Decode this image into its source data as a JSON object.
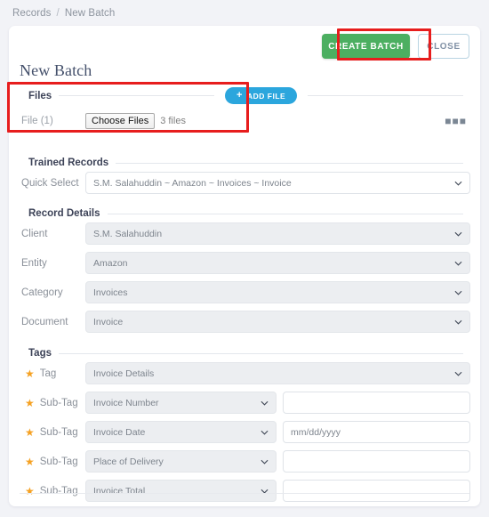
{
  "breadcrumb": {
    "parent": "Records",
    "separator": "/",
    "current": "New Batch"
  },
  "header": {
    "create_batch_label": "CREATE BATCH",
    "close_label": "CLOSE",
    "page_title": "New Batch"
  },
  "colors": {
    "create_button": "#4caf61",
    "add_file_button": "#2ba6dd",
    "highlight_box": "#e71d1d",
    "star": "#f5a122",
    "page_background": "#f2f3f7",
    "disabled_field": "#eceef1"
  },
  "files": {
    "section_label": "Files",
    "add_file_label": "ADD FILE",
    "add_file_icon": "plus-icon",
    "file_row_label": "File (1)",
    "choose_files_label": "Choose Files",
    "file_count_text": "3 files",
    "overflow_icon": "ellipsis-icon"
  },
  "trained_records": {
    "section_label": "Trained Records",
    "quick_select": {
      "label": "Quick Select",
      "value": "S.M. Salahuddin ~ Amazon ~ Invoices ~ Invoice"
    }
  },
  "record_details": {
    "section_label": "Record Details",
    "fields": [
      {
        "label": "Client",
        "value": "S.M. Salahuddin"
      },
      {
        "label": "Entity",
        "value": "Amazon"
      },
      {
        "label": "Category",
        "value": "Invoices"
      },
      {
        "label": "Document",
        "value": "Invoice"
      }
    ]
  },
  "tags": {
    "section_label": "Tags",
    "tag_row": {
      "label": "Tag",
      "icon": "star-icon",
      "value": "Invoice Details"
    },
    "sub_tags": [
      {
        "label": "Sub-Tag",
        "icon": "star-icon",
        "value": "Invoice Number",
        "input_value": "",
        "input_placeholder": ""
      },
      {
        "label": "Sub-Tag",
        "icon": "star-icon",
        "value": "Invoice Date",
        "input_value": "",
        "input_placeholder": "mm/dd/yyyy"
      },
      {
        "label": "Sub-Tag",
        "icon": "star-icon",
        "value": "Place of Delivery",
        "input_value": "",
        "input_placeholder": ""
      },
      {
        "label": "Sub-Tag",
        "icon": "star-icon",
        "value": "Invoice Total",
        "input_value": "",
        "input_placeholder": ""
      }
    ]
  }
}
